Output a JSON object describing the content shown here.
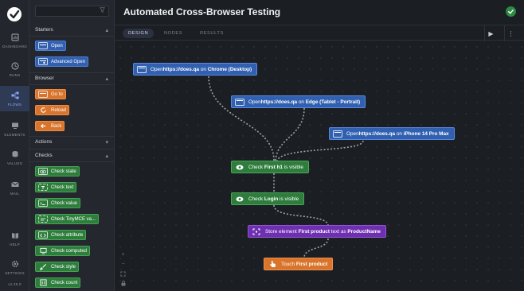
{
  "app": {
    "title": "Automated Cross-Browser Testing",
    "logo_icon": "doesqa-logo-icon",
    "status_icon": "check-badge-icon"
  },
  "rail": {
    "items": [
      {
        "label": "DASHBOARD",
        "icon": "dashboard-icon"
      },
      {
        "label": "RUNS",
        "icon": "runs-icon"
      },
      {
        "label": "FLOWS",
        "icon": "flows-icon",
        "active": true
      },
      {
        "label": "ELEMENTS",
        "icon": "elements-icon"
      },
      {
        "label": "VALUES",
        "icon": "values-icon"
      },
      {
        "label": "MAIL",
        "icon": "mail-icon"
      },
      {
        "label": "HELP",
        "icon": "help-icon"
      },
      {
        "label": "SETTINGS",
        "icon": "settings-icon"
      }
    ],
    "version": "v1.26.0"
  },
  "panel": {
    "search": {
      "placeholder": "",
      "filter_icon": "filter-icon"
    },
    "sections": {
      "starters": {
        "label": "Starters",
        "items": [
          "Open",
          "Advanced Open"
        ]
      },
      "browser": {
        "label": "Browser",
        "items": [
          "Go to",
          "Reload",
          "Back"
        ]
      },
      "actions": {
        "label": "Actions"
      },
      "checks": {
        "label": "Checks",
        "items": [
          "Check state",
          "Check text",
          "Check value",
          "Check TinyMCE va...",
          "Check attribute",
          "Check computed",
          "Check style",
          "Check count"
        ]
      }
    }
  },
  "tabs": [
    "DESIGN",
    "NODES",
    "RESULTS"
  ],
  "active_tab": "DESIGN",
  "toolbar": {
    "run_icon": "play-icon",
    "more_icon": "more-vertical-icon"
  },
  "nodes": {
    "open_chrome": {
      "pre": "Open ",
      "url": "https://does.qa",
      "mid": " on ",
      "target": "Chrome (Desktop)"
    },
    "open_edge": {
      "pre": "Open ",
      "url": "https://does.qa",
      "mid": " on ",
      "target": "Edge (Tablet - Portrait)"
    },
    "open_iphone": {
      "pre": "Open ",
      "url": "https://does.qa",
      "mid": " on ",
      "target": "iPhone 14 Pro Max"
    },
    "check_h1": {
      "pre": "Check ",
      "target": "First h1",
      "post": " is visible"
    },
    "check_login": {
      "pre": "Check ",
      "target": "Login",
      "post": " is visible"
    },
    "store_element": {
      "pre": "Store element ",
      "target": "First product",
      "mid": " text as ",
      "var": "ProductName"
    },
    "touch": {
      "pre": "Touch ",
      "target": "First product"
    }
  },
  "colors": {
    "starter": "#3160b0",
    "browser": "#d8742b",
    "check": "#2e7d3c",
    "store": "#6e2fb0",
    "accent": "#8aa9ff",
    "edge": "#9aa3ad"
  }
}
